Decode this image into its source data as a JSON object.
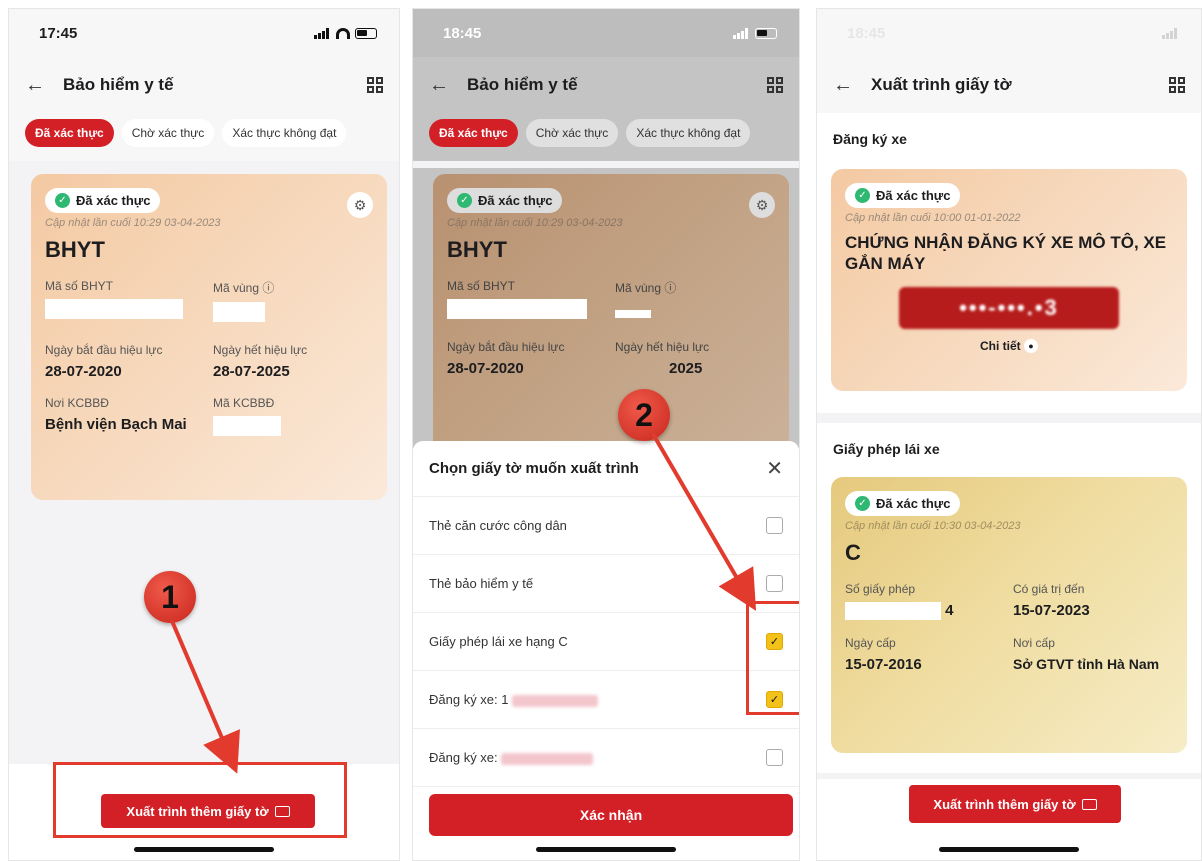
{
  "screen1": {
    "time": "17:45",
    "nav_title": "Bảo hiểm y tế",
    "tabs": [
      "Đã xác thực",
      "Chờ xác thực",
      "Xác thực không đạt"
    ],
    "card": {
      "status": "Đã xác thực",
      "updated": "Cập nhật lần cuối 10:29 03-04-2023",
      "title": "BHYT",
      "field1_label": "Mã số BHYT",
      "field2_label": "Mã vùng ⓘ",
      "start_label": "Ngày bắt đầu hiệu lực",
      "start_value": "28-07-2020",
      "end_label": "Ngày hết hiệu lực",
      "end_value": "28-07-2025",
      "kcb_label": "Nơi KCBBĐ",
      "kcb_value": "Bệnh viện Bạch Mai",
      "makcb_label": "Mã KCBBĐ"
    },
    "marker": "1",
    "button": "Xuất trình thêm giấy tờ"
  },
  "screen2": {
    "time": "18:45",
    "nav_title": "Bảo hiểm y tế",
    "tabs": [
      "Đã xác thực",
      "Chờ xác thực",
      "Xác thực không đạt"
    ],
    "card": {
      "status": "Đã xác thực",
      "updated": "Cập nhật lần cuối 10:29 03-04-2023",
      "title": "BHYT",
      "field1_label": "Mã số BHYT",
      "field2_label": "Mã vùng ⓘ",
      "start_label": "Ngày bắt đầu hiệu lực",
      "start_value": "28-07-2020",
      "end_label": "Ngày hết hiệu lực",
      "end_value": "2025"
    },
    "marker": "2",
    "sheet_title": "Chọn giấy tờ muốn xuất trình",
    "options": [
      {
        "label": "Thẻ căn cước công dân",
        "checked": false
      },
      {
        "label": "Thẻ bảo hiểm y tế",
        "checked": false
      },
      {
        "label": "Giấy phép lái xe hạng C",
        "checked": true
      },
      {
        "label": "Đăng ký xe: 1",
        "checked": true
      },
      {
        "label": "Đăng ký xe:",
        "checked": false
      }
    ],
    "confirm": "Xác nhận"
  },
  "screen3": {
    "nav_title": "Xuất trình giấy tờ",
    "section1": "Đăng ký xe",
    "reg_card": {
      "status": "Đã xác thực",
      "updated": "Cập nhật lần cuối 10:00 01-01-2022",
      "title": "CHỨNG NHẬN ĐĂNG KÝ XE MÔ TÔ, XE GẮN MÁY",
      "plate": "•••-•••.•3",
      "detail": "Chi tiết"
    },
    "section2": "Giấy phép lái xe",
    "license_card": {
      "status": "Đã xác thực",
      "updated": "Cập nhật lần cuối 10:30 03-04-2023",
      "title": "C",
      "num_label": "Số giấy phép",
      "num_value": "4",
      "valid_label": "Có giá trị đến",
      "valid_value": "15-07-2023",
      "issue_label": "Ngày cấp",
      "issue_value": "15-07-2016",
      "place_label": "Nơi cấp",
      "place_value": "Sở GTVT tỉnh Hà Nam"
    },
    "button": "Xuất trình thêm giấy tờ"
  },
  "colors": {
    "brand_red": "#d32027",
    "verified_green": "#2eb872",
    "check_yellow": "#f2c21a"
  },
  "icons": [
    "back-arrow-icon",
    "qr-code-icon",
    "check-circle-icon",
    "gear-icon",
    "id-card-icon",
    "close-icon",
    "eye-icon"
  ]
}
